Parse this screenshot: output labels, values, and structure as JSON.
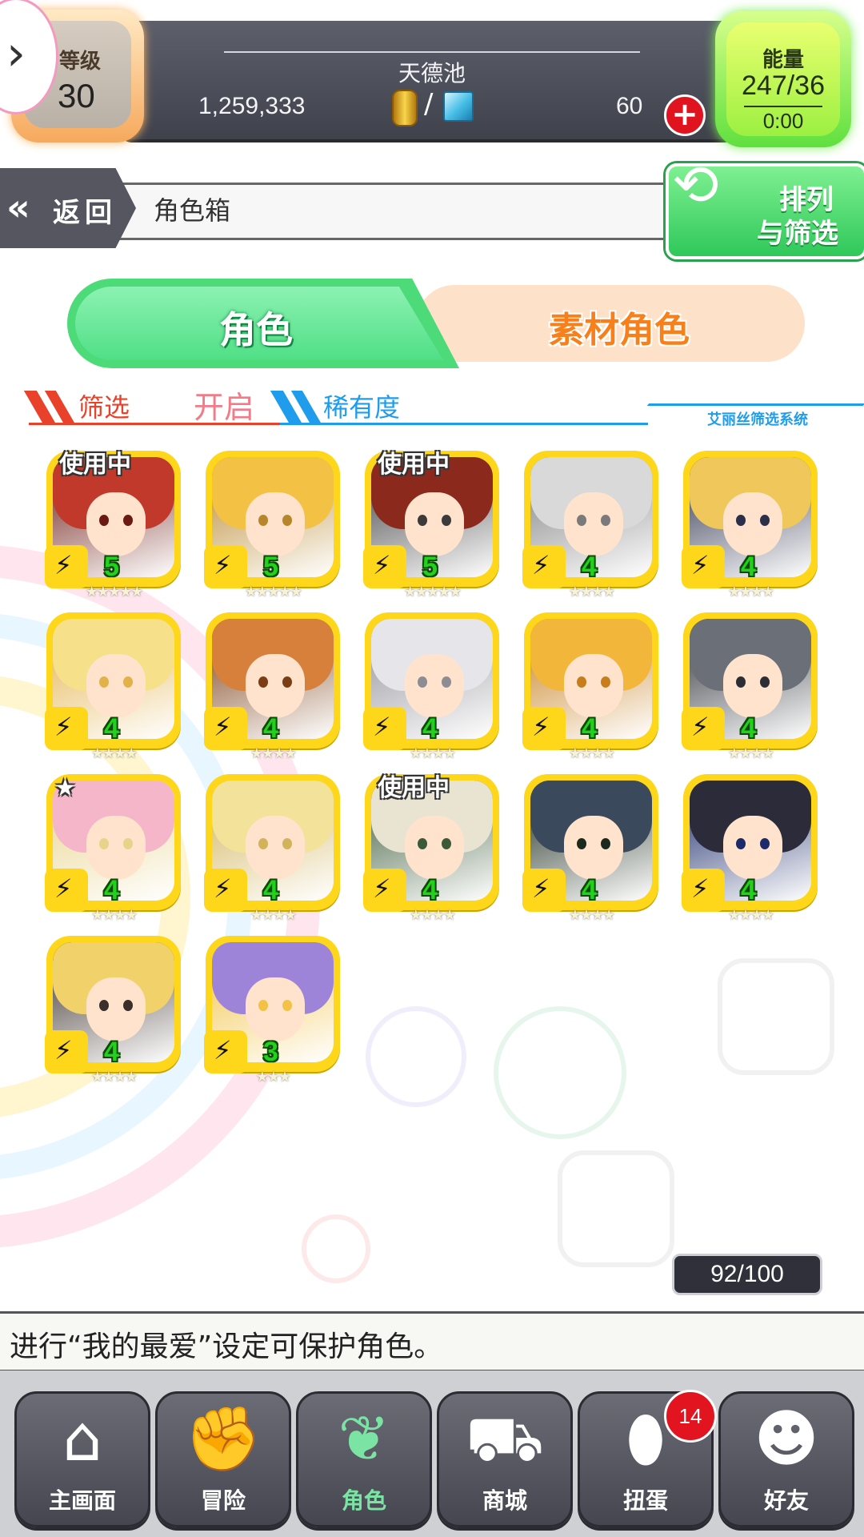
{
  "status": {
    "level_label": "等级",
    "level_value": "30",
    "pool_name": "天德池",
    "gold": "1,259,333",
    "currency_separator": "/",
    "gems": "60",
    "energy_label": "能量",
    "energy_value": "247/36",
    "energy_timer": "0:00"
  },
  "header": {
    "back_label": "返回",
    "page_title": "角色箱",
    "sort_filter_line1": "排列",
    "sort_filter_line2": "与筛选"
  },
  "tabs": {
    "characters": "角色",
    "material_characters": "素材角色"
  },
  "filter": {
    "filter_label": "筛选",
    "filter_state": "开启",
    "rarity_label": "稀有度",
    "system_label": "艾丽丝筛选系统"
  },
  "characters": [
    {
      "rank": "5",
      "stars": "★★★★★",
      "in_use": "使用中",
      "favorite": ""
    },
    {
      "rank": "5",
      "stars": "★★★★★",
      "in_use": "",
      "favorite": ""
    },
    {
      "rank": "5",
      "stars": "★★★★★",
      "in_use": "使用中",
      "favorite": ""
    },
    {
      "rank": "4",
      "stars": "★★★★",
      "in_use": "",
      "favorite": ""
    },
    {
      "rank": "4",
      "stars": "★★★★",
      "in_use": "",
      "favorite": ""
    },
    {
      "rank": "4",
      "stars": "★★★★",
      "in_use": "",
      "favorite": ""
    },
    {
      "rank": "4",
      "stars": "★★★★",
      "in_use": "",
      "favorite": ""
    },
    {
      "rank": "4",
      "stars": "★★★★",
      "in_use": "",
      "favorite": ""
    },
    {
      "rank": "4",
      "stars": "★★★★",
      "in_use": "",
      "favorite": ""
    },
    {
      "rank": "4",
      "stars": "★★★★",
      "in_use": "",
      "favorite": ""
    },
    {
      "rank": "4",
      "stars": "★★★★",
      "in_use": "",
      "favorite": "★"
    },
    {
      "rank": "4",
      "stars": "★★★★",
      "in_use": "",
      "favorite": ""
    },
    {
      "rank": "4",
      "stars": "★★★★",
      "in_use": "使用中",
      "favorite": ""
    },
    {
      "rank": "4",
      "stars": "★★★★",
      "in_use": "",
      "favorite": ""
    },
    {
      "rank": "4",
      "stars": "★★★★",
      "in_use": "",
      "favorite": ""
    },
    {
      "rank": "4",
      "stars": "★★★★",
      "in_use": "",
      "favorite": ""
    },
    {
      "rank": "3",
      "stars": "★★★",
      "in_use": "",
      "favorite": ""
    }
  ],
  "capacity": "92/100",
  "tip": "进行“我的最爱”设定可保护角色。",
  "nav": {
    "home": "主画面",
    "adventure": "冒险",
    "characters": "角色",
    "shop": "商城",
    "gacha": "扭蛋",
    "gacha_badge": "14",
    "friends": "好友"
  },
  "colors": {
    "accent_green": "#4ddb7a",
    "tab_orange": "#f7801a",
    "card_frame": "#ffd71a",
    "rank_green": "#22d11c",
    "filter_red": "#e8422b",
    "filter_blue": "#1f9dec",
    "badge_red": "#e2141f"
  }
}
